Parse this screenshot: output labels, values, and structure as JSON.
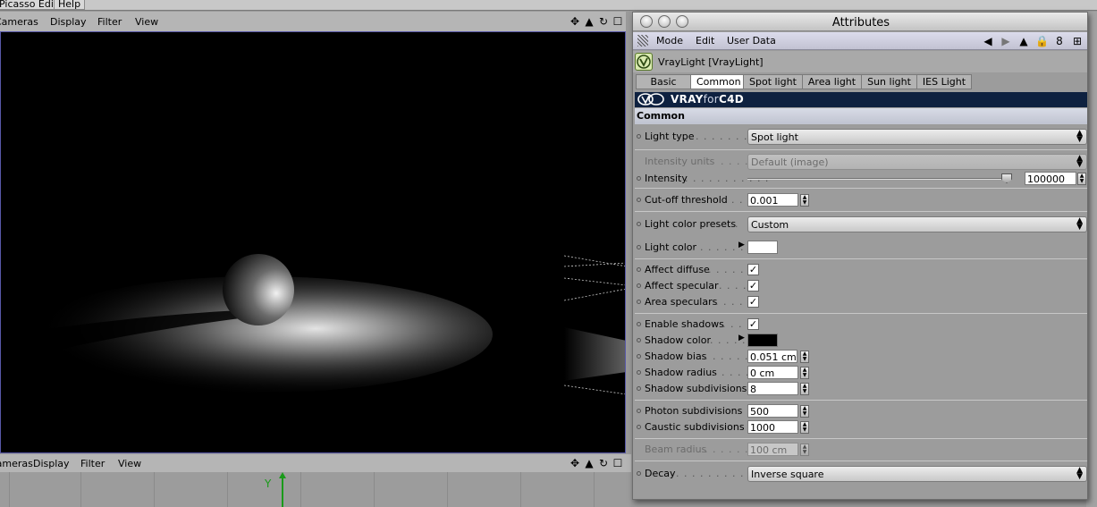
{
  "top_menu": {
    "left_item": "Picasso Editor",
    "help": "Help"
  },
  "viewport_menu": {
    "cameras": "Cameras",
    "display": "Display",
    "filter": "Filter",
    "view": "View"
  },
  "viewport2_menu": {
    "cameras": "Cameras",
    "display": "Display",
    "filter": "Filter",
    "view": "View",
    "axis_label": "Y"
  },
  "viewport_icons": [
    "move-icon",
    "zoom-icon",
    "rotate-icon",
    "maximize-icon"
  ],
  "attributes": {
    "title": "Attributes",
    "menu": {
      "mode": "Mode",
      "edit": "Edit",
      "user_data": "User Data"
    },
    "nav_icons": [
      "back-arrow-icon",
      "up-arrow-icon",
      "lock-icon",
      "link-icon",
      "new-window-icon"
    ],
    "object_title": "VrayLight [VrayLight]",
    "tabs": [
      "Basic",
      "Common",
      "Spot light",
      "Area light",
      "Sun light",
      "IES Light"
    ],
    "active_tab": "Common",
    "banner": {
      "prefix": "VRAY",
      "middle": "for",
      "suffix": "C4D"
    },
    "section": "Common",
    "props": {
      "light_type": {
        "label": "Light type",
        "value": "Spot light"
      },
      "intensity_units": {
        "label": "Intensity units",
        "value": "Default (image)"
      },
      "intensity": {
        "label": "Intensity",
        "value": "100000",
        "slider_fraction": 1.0
      },
      "cutoff": {
        "label": "Cut-off threshold",
        "value": "0.001"
      },
      "color_presets": {
        "label": "Light color presets",
        "value": "Custom"
      },
      "light_color": {
        "label": "Light color",
        "color": "#ffffff"
      },
      "affect_diffuse": {
        "label": "Affect diffuse",
        "checked": "✓"
      },
      "affect_specular": {
        "label": "Affect specular",
        "checked": "✓"
      },
      "area_speculars": {
        "label": "Area speculars",
        "checked": "✓"
      },
      "enable_shadows": {
        "label": "Enable shadows",
        "checked": "✓"
      },
      "shadow_color": {
        "label": "Shadow color",
        "color": "#000000"
      },
      "shadow_bias": {
        "label": "Shadow bias",
        "value": "0.051 cm"
      },
      "shadow_radius": {
        "label": "Shadow radius",
        "value": "0 cm"
      },
      "shadow_subdivisions": {
        "label": "Shadow subdivisions",
        "value": "8"
      },
      "photon_subdivisions": {
        "label": "Photon subdivisions",
        "value": "500"
      },
      "caustic_subdivisions": {
        "label": "Caustic subdivisions",
        "value": "1000"
      },
      "beam_radius": {
        "label": "Beam radius",
        "value": "100 cm"
      },
      "decay": {
        "label": "Decay",
        "value": "Inverse square"
      }
    }
  }
}
